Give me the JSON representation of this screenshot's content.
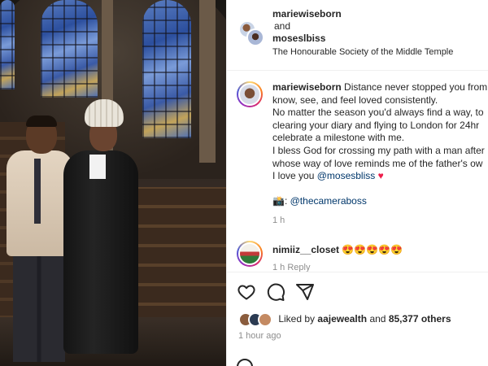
{
  "post": {
    "authors": [
      "mariewiseborn",
      "moseslbiss"
    ],
    "and_text": "and",
    "location": "The Honourable Society of the Middle Temple"
  },
  "caption": {
    "username": "mariewiseborn",
    "lines": [
      "Distance never stopped you from",
      "know, see, and feel loved consistently.",
      "No matter the season you'd always find a way, to",
      "clearing your diary and flying to London for 24hr",
      "celebrate a milestone with me.",
      "I bless God for crossing my path with a man after",
      "whose way of love reminds me of the father's ow"
    ],
    "love_prefix": "I love you",
    "love_mention": "@mosesbliss",
    "heart": "♥",
    "credit_emoji": "📸",
    "credit_mention": "@thecameraboss",
    "time": "1 h"
  },
  "comment": {
    "username": "nimiiz__closet",
    "text": "😍😍😍😍😍",
    "meta": "1 h  Reply"
  },
  "engagement": {
    "liked_by_prefix": "Liked by",
    "liked_by_user": "aajewealth",
    "and_text": "and",
    "others": "85,377 others",
    "posted_ago": "1 hour ago"
  },
  "icons": [
    "heart-icon",
    "comment-icon",
    "share-icon",
    "emoji-icon"
  ],
  "colors": {
    "mention": "#00376b",
    "heart": "#ed1c4a",
    "muted": "#8e8e8e"
  }
}
